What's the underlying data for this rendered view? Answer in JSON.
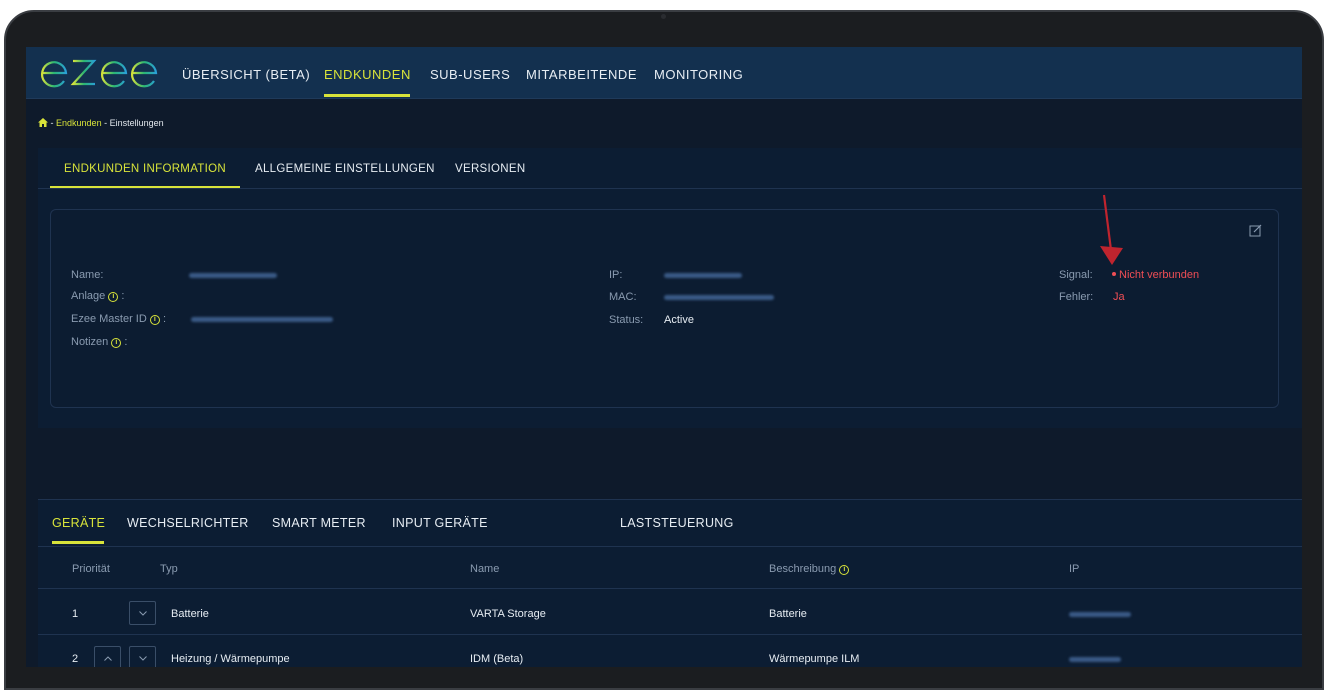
{
  "nav": {
    "logo_text": "ezee",
    "items": [
      {
        "label": "ÜBERSICHT (BETA)"
      },
      {
        "label": "ENDKUNDEN"
      },
      {
        "label": "SUB-USERS"
      },
      {
        "label": "MITARBEITENDE"
      },
      {
        "label": "MONITORING"
      }
    ],
    "active_index": 1
  },
  "breadcrumb": {
    "home_icon": "home-icon",
    "sep": "-",
    "link": "Endkunden",
    "current": "Einstellungen"
  },
  "info_tabs": [
    {
      "label": "ENDKUNDEN INFORMATION",
      "active": true
    },
    {
      "label": "ALLGEMEINE EINSTELLUNGEN",
      "active": false
    },
    {
      "label": "VERSIONEN",
      "active": false
    }
  ],
  "customer": {
    "name_label": "Name:",
    "name_value": "",
    "anlage_label": "Anlage",
    "colon": ":",
    "master_label": "Ezee Master ID",
    "master_value": "",
    "notizen_label": "Notizen",
    "ip_label": "IP:",
    "ip_value": "",
    "mac_label": "MAC:",
    "mac_value": "",
    "status_label": "Status:",
    "status_value": "Active",
    "signal_label": "Signal:",
    "signal_value": "Nicht verbunden",
    "fehler_label": "Fehler:",
    "fehler_value": "Ja"
  },
  "device_tabs": [
    {
      "label": "GERÄTE",
      "active": true
    },
    {
      "label": "WECHSELRICHTER",
      "active": false
    },
    {
      "label": "SMART METER",
      "active": false
    },
    {
      "label": "INPUT GERÄTE",
      "active": false
    },
    {
      "label": "LASTSTEUERUNG",
      "active": false
    }
  ],
  "devices_table": {
    "columns": [
      "Priorität",
      "Typ",
      "Name",
      "Beschreibung",
      "IP"
    ],
    "rows": [
      {
        "priority": "1",
        "type": "Batterie",
        "name": "VARTA Storage",
        "description": "Batterie",
        "ip": ""
      },
      {
        "priority": "2",
        "type": "Heizung / Wärmepumpe",
        "name": "IDM (Beta)",
        "description": "Wärmepumpe ILM",
        "ip": ""
      }
    ]
  },
  "colors": {
    "accent": "#d8e33a",
    "nav_bg": "#13304f",
    "page_bg": "#0e1a2b",
    "error": "#ef4e55",
    "arrow": "#c0242e"
  }
}
